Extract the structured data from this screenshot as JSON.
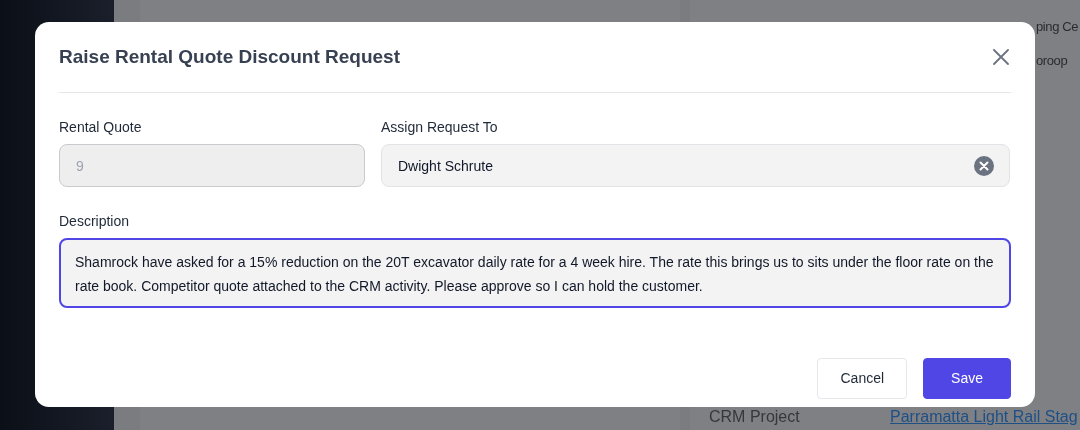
{
  "background": {
    "right_texts": [
      "ping Ce",
      "oroop"
    ],
    "bottom_label": "CRM Project",
    "bottom_link": "Parramatta Light Rail Stag"
  },
  "modal": {
    "title": "Raise Rental Quote Discount Request",
    "fields": [
      {
        "label": "Rental Quote",
        "value": "9",
        "disabled": true,
        "clearable": false
      },
      {
        "label": "Assign Request To",
        "value": "Dwight Schrute",
        "disabled": false,
        "clearable": true
      }
    ],
    "description": {
      "label": "Description",
      "value": "Shamrock have asked for a 15% reduction on the 20T excavator daily rate for a 4 week hire. The rate this brings us to sits under the floor rate on the rate book. Competitor quote attached to the CRM activity. Please approve so I can hold the customer.",
      "focused": true
    },
    "buttons": [
      {
        "label": "Cancel",
        "kind": "secondary"
      },
      {
        "label": "Save",
        "kind": "primary"
      }
    ]
  }
}
